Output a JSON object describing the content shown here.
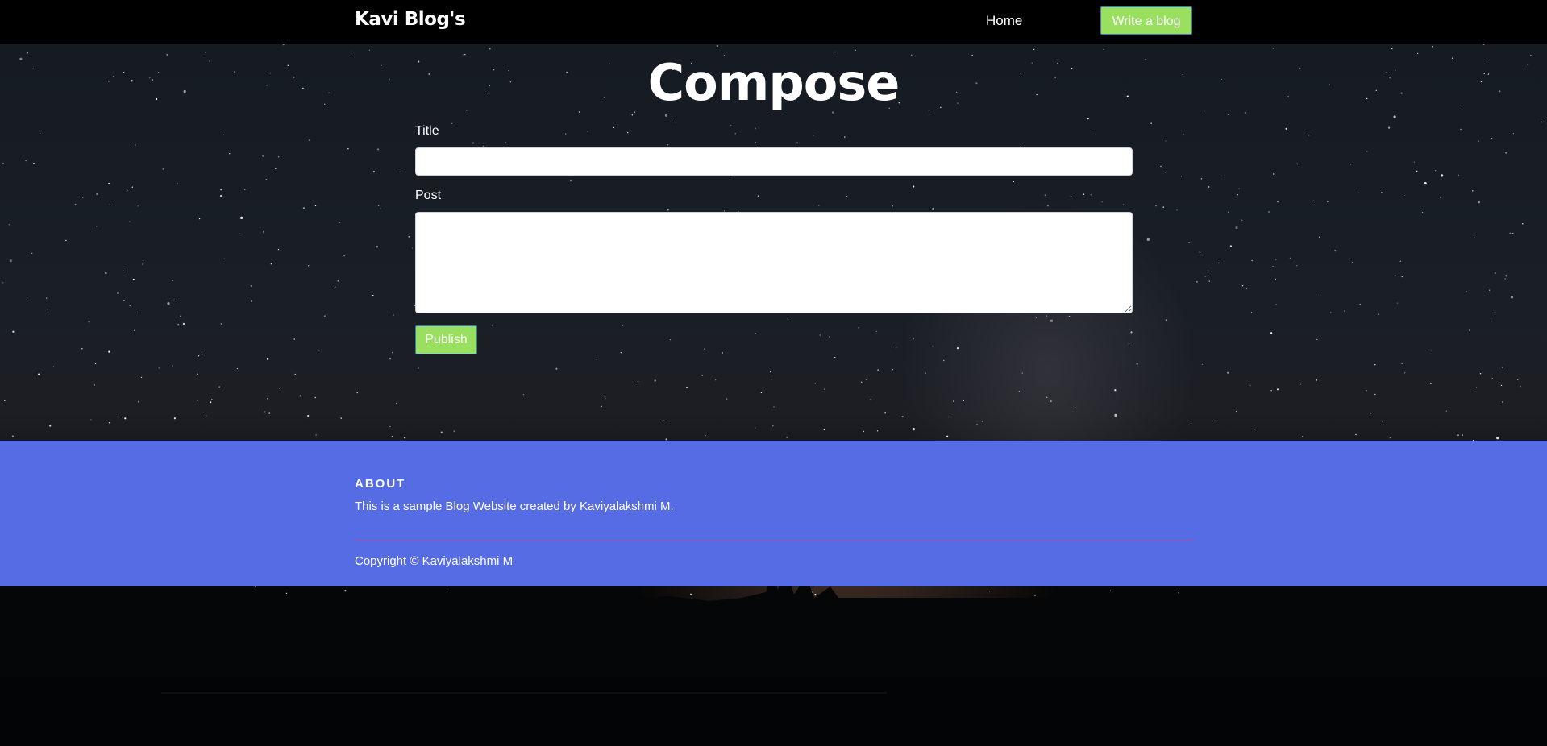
{
  "navbar": {
    "brand": "Kavi Blog's",
    "home_label": "Home",
    "write_label": "Write a blog"
  },
  "compose": {
    "heading": "Compose",
    "title_label": "Title",
    "title_value": "",
    "post_label": "Post",
    "post_value": "",
    "publish_label": "Publish"
  },
  "footer": {
    "about_heading": "ABOUT",
    "about_text": "This is a sample Blog Website created by Kaviyalakshmi M.",
    "copyright": "Copyright © Kaviyalakshmi M"
  },
  "colors": {
    "navbar_bg": "#000000",
    "button_bg": "#99e060",
    "button_border": "#2b7fbf",
    "footer_bg": "#566ce4",
    "divider": "#b3489b"
  }
}
